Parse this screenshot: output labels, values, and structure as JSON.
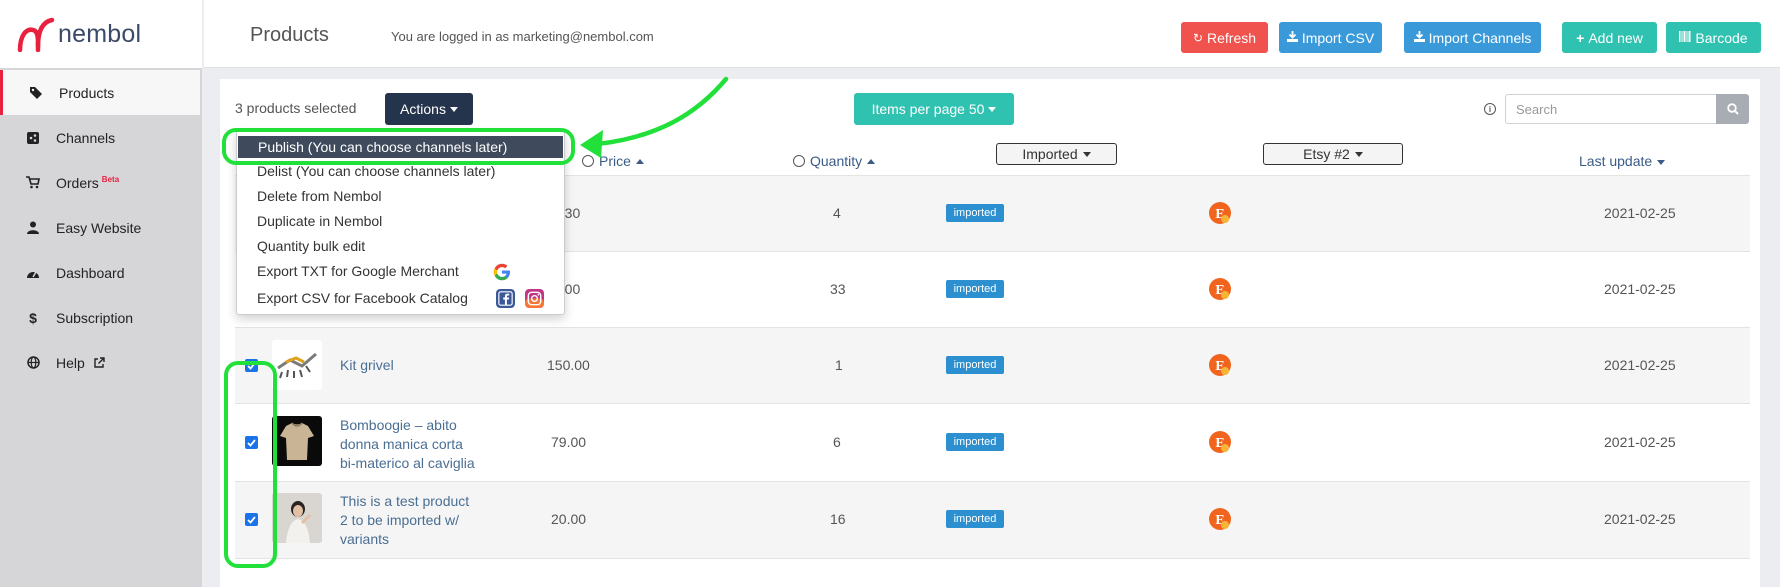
{
  "app": {
    "logo_text": "nembol"
  },
  "sidebar": {
    "items": [
      {
        "label": "Products",
        "icon": "tag-icon"
      },
      {
        "label": "Channels",
        "icon": "share-icon"
      },
      {
        "label": "Orders",
        "badge": "Beta",
        "icon": "cart-icon"
      },
      {
        "label": "Easy Website",
        "icon": "user-icon"
      },
      {
        "label": "Dashboard",
        "icon": "dashboard-icon"
      },
      {
        "label": "Subscription",
        "icon": "dollar-icon"
      },
      {
        "label": "Help",
        "icon": "globe-icon",
        "external_icon": "external-link-icon"
      }
    ]
  },
  "header": {
    "title": "Products",
    "login_info": "You are logged in as marketing@nembol.com",
    "buttons": {
      "refresh": "Refresh",
      "import_csv": "Import CSV",
      "import_channels": "Import Channels",
      "add_new": "Add new",
      "barcode": "Barcode"
    },
    "colors": {
      "refresh": "#f0524d",
      "import": "#3a9ad9",
      "add": "#30c2b1"
    }
  },
  "toolbar": {
    "selected_text": "3 products selected",
    "actions_label": "Actions",
    "items_per_page_label": "Items per page 50",
    "search_placeholder": "Search"
  },
  "dropdown": {
    "items": [
      "Publish (You can choose channels later)",
      "Delist (You can choose channels later)",
      "Delete from Nembol",
      "Duplicate in Nembol",
      "Quantity bulk edit",
      "Export TXT for Google Merchant",
      "Export CSV for Facebook Catalog"
    ]
  },
  "table": {
    "headers": {
      "price": "Price",
      "quantity": "Quantity",
      "imported": "Imported",
      "etsy": "Etsy #2",
      "last_update": "Last update"
    },
    "rows": [
      {
        "name": "",
        "price": "1.30",
        "quantity": "4",
        "status": "imported",
        "date": "2021-02-25",
        "checked": false
      },
      {
        "name": "",
        "price": "1.00",
        "quantity": "33",
        "status": "imported",
        "date": "2021-02-25",
        "checked": false
      },
      {
        "name": "Kit grivel",
        "price": "150.00",
        "quantity": "1",
        "status": "imported",
        "date": "2021-02-25",
        "checked": true
      },
      {
        "name_lines": [
          "Bomboogie – abito",
          "donna manica corta",
          "bi-materico al caviglia"
        ],
        "price": "79.00",
        "quantity": "6",
        "status": "imported",
        "date": "2021-02-25",
        "checked": true
      },
      {
        "name_lines": [
          "This is a test product",
          "2 to be imported w/",
          "variants"
        ],
        "price": "20.00",
        "quantity": "16",
        "status": "imported",
        "date": "2021-02-25",
        "checked": true
      }
    ]
  },
  "annotation_color": "#22e03a"
}
